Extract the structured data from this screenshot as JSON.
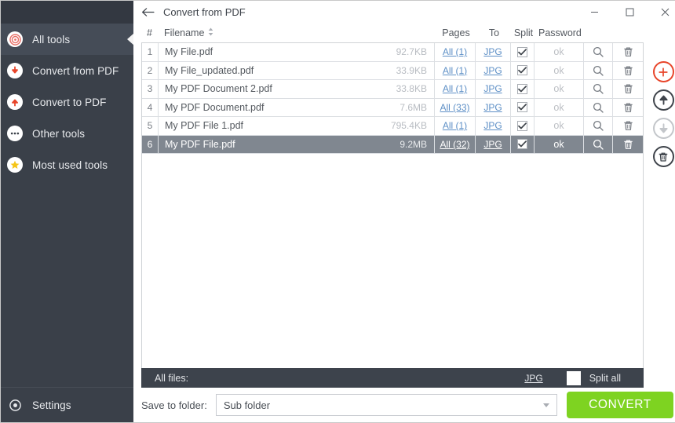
{
  "sidebar": {
    "items": [
      {
        "label": "All tools",
        "icon": "target-icon",
        "active": true
      },
      {
        "label": "Convert from PDF",
        "icon": "arrow-down-circle-icon",
        "active": false
      },
      {
        "label": "Convert to PDF",
        "icon": "arrow-up-circle-icon",
        "active": false
      },
      {
        "label": "Other tools",
        "icon": "ellipsis-icon",
        "active": false
      },
      {
        "label": "Most used tools",
        "icon": "star-icon",
        "active": false
      }
    ],
    "settings": {
      "label": "Settings",
      "icon": "gear-icon"
    }
  },
  "titlebar": {
    "back_icon": "back-arrow-icon",
    "title": "Convert from PDF",
    "minimize": "–",
    "maximize": "□",
    "close": "✕"
  },
  "table": {
    "headers": {
      "num": "#",
      "filename": "Filename",
      "pages": "Pages",
      "to": "To",
      "split": "Split",
      "password": "Password"
    },
    "rows": [
      {
        "num": "1",
        "filename": "My File.pdf",
        "size": "92.7KB",
        "pages": "All (1)",
        "to": "JPG",
        "split": true,
        "password": "ok",
        "selected": false
      },
      {
        "num": "2",
        "filename": "My File_updated.pdf",
        "size": "33.9KB",
        "pages": "All (1)",
        "to": "JPG",
        "split": true,
        "password": "ok",
        "selected": false
      },
      {
        "num": "3",
        "filename": "My PDF Document 2.pdf",
        "size": "33.8KB",
        "pages": "All (1)",
        "to": "JPG",
        "split": true,
        "password": "ok",
        "selected": false
      },
      {
        "num": "4",
        "filename": "My PDF Document.pdf",
        "size": "7.6MB",
        "pages": "All (33)",
        "to": "JPG",
        "split": true,
        "password": "ok",
        "selected": false
      },
      {
        "num": "5",
        "filename": "My PDF File 1.pdf",
        "size": "795.4KB",
        "pages": "All (1)",
        "to": "JPG",
        "split": true,
        "password": "ok",
        "selected": false
      },
      {
        "num": "6",
        "filename": "My PDF File.pdf",
        "size": "9.2MB",
        "pages": "All (32)",
        "to": "JPG",
        "split": true,
        "password": "ok",
        "selected": true
      }
    ]
  },
  "all_files_bar": {
    "label": "All files:",
    "format": "JPG",
    "split_all_label": "Split all",
    "split_all_checked": false
  },
  "side_actions": [
    {
      "name": "add-file-button",
      "icon": "plus-circle-icon",
      "color": "#e8452a",
      "enabled": true
    },
    {
      "name": "move-up-button",
      "icon": "arrow-up-circle-icon",
      "color": "#3f444b",
      "enabled": true
    },
    {
      "name": "move-down-button",
      "icon": "arrow-down-circle-icon",
      "color": "#c3c6ca",
      "enabled": false
    },
    {
      "name": "delete-all-button",
      "icon": "trash-circle-icon",
      "color": "#3f444b",
      "enabled": true
    }
  ],
  "footer": {
    "save_label": "Save to folder:",
    "folder_value": "Sub folder",
    "convert_label": "CONVERT"
  },
  "colors": {
    "sidebar_bg": "#3a4049",
    "sidebar_top": "#333841",
    "sidebar_active": "#454c57",
    "accent_red": "#e8452a",
    "accent_green": "#7ed321",
    "link_blue": "#5d8fc6",
    "selected_row": "#808790",
    "dark_bar": "#3d434c"
  }
}
